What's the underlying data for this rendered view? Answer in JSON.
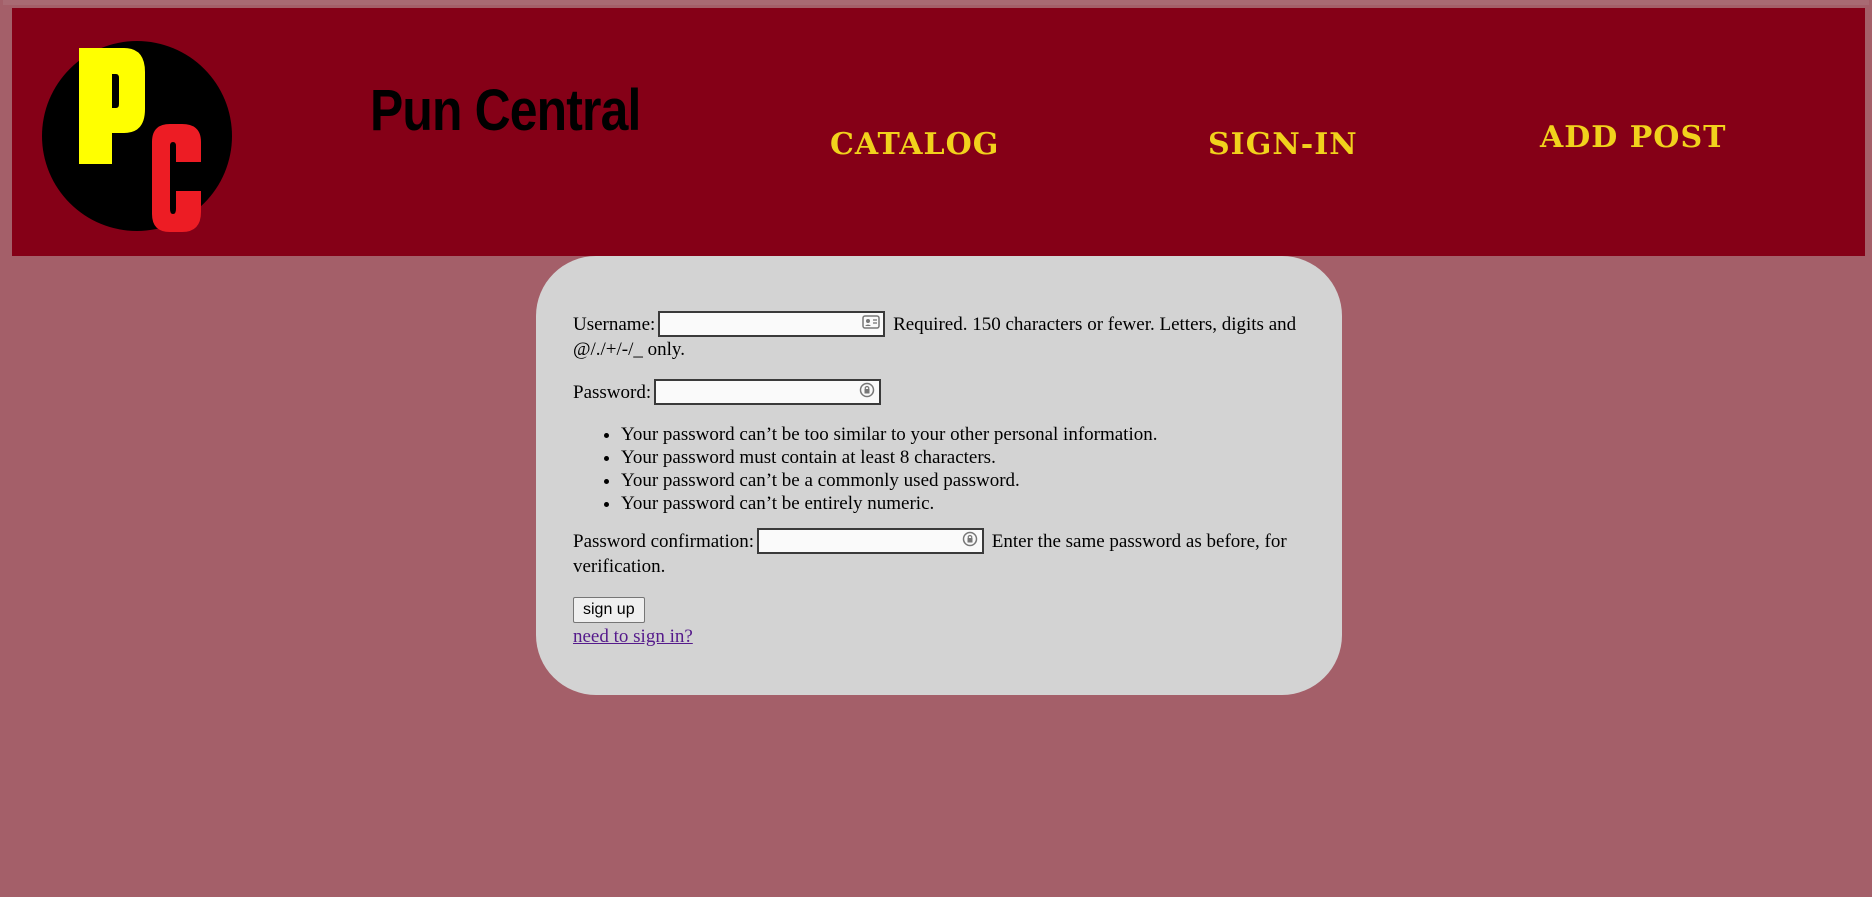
{
  "header": {
    "logo_letters": [
      "P",
      "C"
    ],
    "site_title": "Pun Central",
    "nav": {
      "catalog": "CATALOG",
      "signin": "SIGN-IN",
      "add_post": "ADD POST"
    },
    "colors": {
      "banner": "#850017",
      "nav_text": "#f1d21c",
      "logo_p": "#ffff00",
      "logo_c": "#ed1c24"
    }
  },
  "form": {
    "username": {
      "label": "Username:",
      "value": "",
      "help": "Required. 150 characters or fewer. Letters, digits and @/./+/-/_ only."
    },
    "password": {
      "label": "Password:",
      "value": "",
      "rules": [
        "Your password can’t be too similar to your other personal information.",
        "Your password must contain at least 8 characters.",
        "Your password can’t be a commonly used password.",
        "Your password can’t be entirely numeric."
      ]
    },
    "password_confirmation": {
      "label": "Password confirmation:",
      "value": "",
      "help": "Enter the same password as before, for verification."
    },
    "submit_label": "sign up",
    "signin_link": "need to sign in?"
  },
  "icons": {
    "username_field": "contact-card-icon",
    "password_field": "key-lock-icon",
    "confirm_field": "key-lock-icon"
  }
}
